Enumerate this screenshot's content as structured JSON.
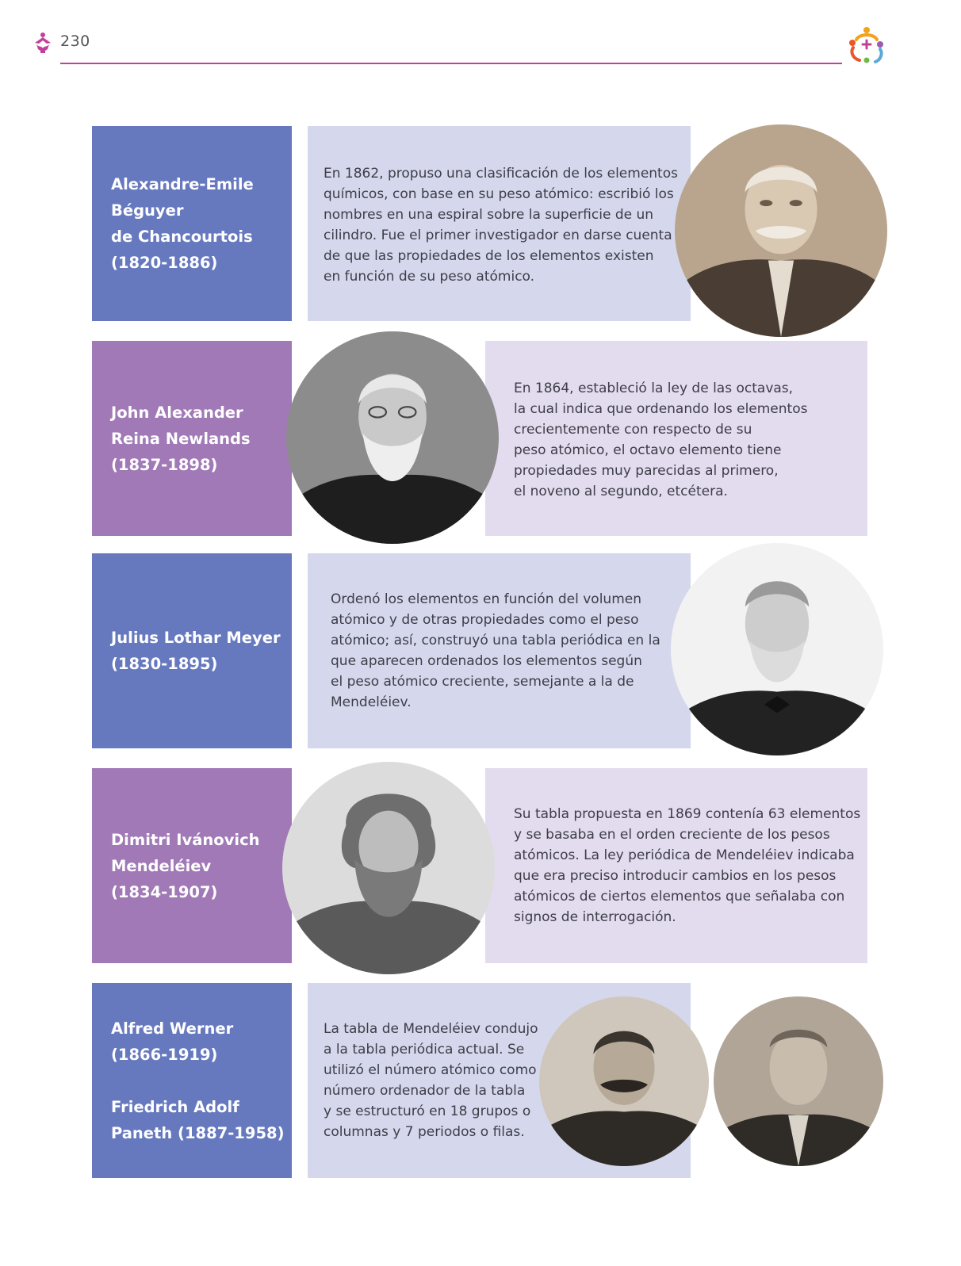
{
  "header": {
    "page_number": "230"
  },
  "scientists": [
    {
      "name_lines": [
        "Alexandre-Emile",
        "Béguyer",
        "de Chancourtois",
        "(1820-1886)"
      ],
      "desc_lines": [
        "En 1862, propuso una clasificación de los elementos",
        "químicos, con base en su peso atómico: escribió los",
        "nombres en una espiral sobre la superficie de un",
        "cilindro. Fue el primer investigador en darse cuenta",
        "de que las propiedades de los elementos existen",
        "en función de su peso atómico."
      ]
    },
    {
      "name_lines": [
        "John Alexander",
        "Reina Newlands",
        "(1837-1898)"
      ],
      "desc_lines": [
        "En 1864, estableció la ley de las octavas,",
        "la cual indica que ordenando los elementos",
        "crecientemente con respecto de su",
        "peso atómico, el octavo elemento tiene",
        "propiedades muy parecidas al primero,",
        "el noveno al segundo, etcétera."
      ]
    },
    {
      "name_lines": [
        "Julius Lothar Meyer",
        "(1830-1895)"
      ],
      "desc_lines": [
        "Ordenó los elementos en función del volumen",
        "atómico y de otras propiedades como el peso",
        "atómico; así, construyó una tabla periódica en la",
        "que aparecen ordenados los elementos según",
        "el peso atómico creciente, semejante a la de",
        "Mendeléiev."
      ]
    },
    {
      "name_lines": [
        "Dimitri Ivánovich",
        "Mendeléiev",
        "(1834-1907)"
      ],
      "desc_lines": [
        "Su tabla propuesta en 1869 contenía 63 elementos",
        "y se basaba en el orden creciente de los pesos",
        "atómicos. La ley periódica de Mendeléiev indicaba",
        "que era preciso introducir cambios en los pesos",
        "atómicos de ciertos elementos que señalaba con",
        "signos de interrogación."
      ]
    },
    {
      "name_lines": [
        "Alfred Werner",
        "(1866-1919)",
        "",
        "Friedrich Adolf",
        "Paneth (1887-1958)"
      ],
      "desc_lines": [
        "La tabla de Mendeléiev condujo",
        "a la tabla periódica actual. Se",
        "utilizó el número atómico como",
        "número ordenador de la tabla",
        "y se estructuró en 18 grupos o",
        "columnas y 7 periodos o filas."
      ]
    }
  ],
  "colors": {
    "accent_magenta": "#c2409a",
    "name_blue": "#6679bf",
    "name_purple": "#a079b6",
    "desc_blue": "#d5d8ec",
    "desc_purple": "#e3dbee"
  },
  "icons": {
    "header_ornament": "floral-ornament-icon",
    "header_logo": "people-circle-logo"
  }
}
